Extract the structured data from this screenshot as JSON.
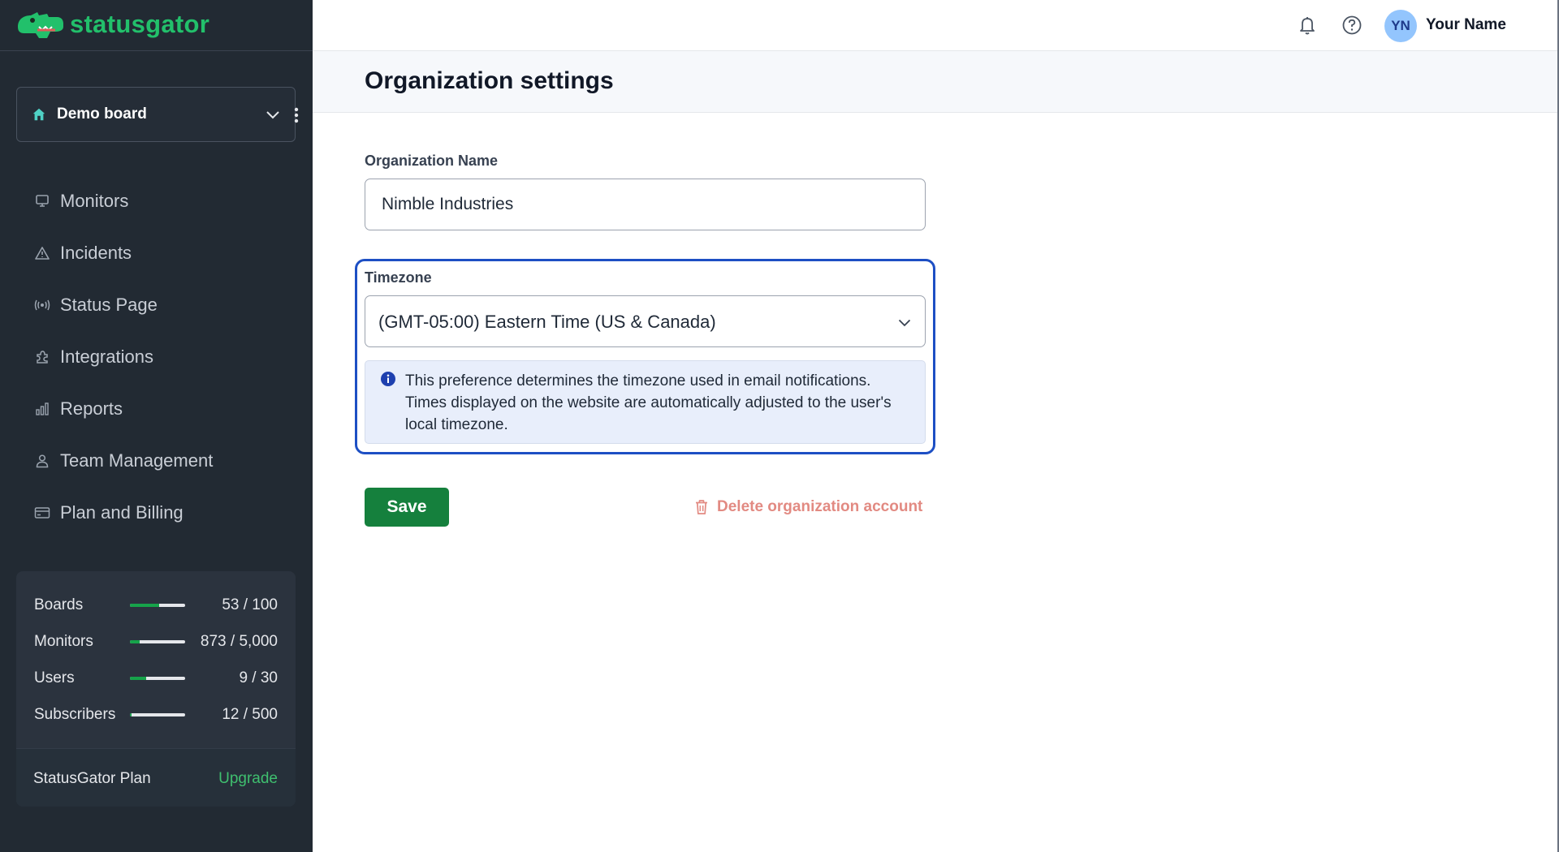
{
  "brand": {
    "name": "statusgator",
    "logo_icon": "gator-logo-icon"
  },
  "board_select": {
    "name": "Demo board",
    "icon": "home-icon"
  },
  "sidebar": {
    "items": [
      {
        "label": "Monitors",
        "icon": "monitor-icon"
      },
      {
        "label": "Incidents",
        "icon": "warning-triangle-icon"
      },
      {
        "label": "Status Page",
        "icon": "broadcast-icon"
      },
      {
        "label": "Integrations",
        "icon": "puzzle-icon"
      },
      {
        "label": "Reports",
        "icon": "bar-chart-icon"
      },
      {
        "label": "Team Management",
        "icon": "user-icon"
      },
      {
        "label": "Plan and Billing",
        "icon": "credit-card-icon"
      }
    ]
  },
  "usage": {
    "rows": [
      {
        "label": "Boards",
        "value": "53 / 100",
        "fraction": 0.53
      },
      {
        "label": "Monitors",
        "value": "873 / 5,000",
        "fraction": 0.175
      },
      {
        "label": "Users",
        "value": "9 / 30",
        "fraction": 0.3
      },
      {
        "label": "Subscribers",
        "value": "12 / 500",
        "fraction": 0.024
      }
    ],
    "plan": "StatusGator Plan",
    "upgrade": "Upgrade"
  },
  "topbar": {
    "initials": "YN",
    "user_name": "Your Name"
  },
  "page": {
    "title": "Organization settings",
    "org_name_label": "Organization Name",
    "org_name_value": "Nimble Industries",
    "timezone_label": "Timezone",
    "timezone_value": "(GMT-05:00) Eastern Time (US & Canada)",
    "timezone_info": "This preference determines the timezone used in email notifications. Times displayed on the website are automatically adjusted to the user's local timezone.",
    "save": "Save",
    "delete": "Delete organization account"
  },
  "colors": {
    "sidebar_bg": "#222a33",
    "brand_green": "#22c06b",
    "save_green": "#15803d",
    "focus_blue": "#1d4fc4",
    "delete_red": "#e28a82"
  }
}
